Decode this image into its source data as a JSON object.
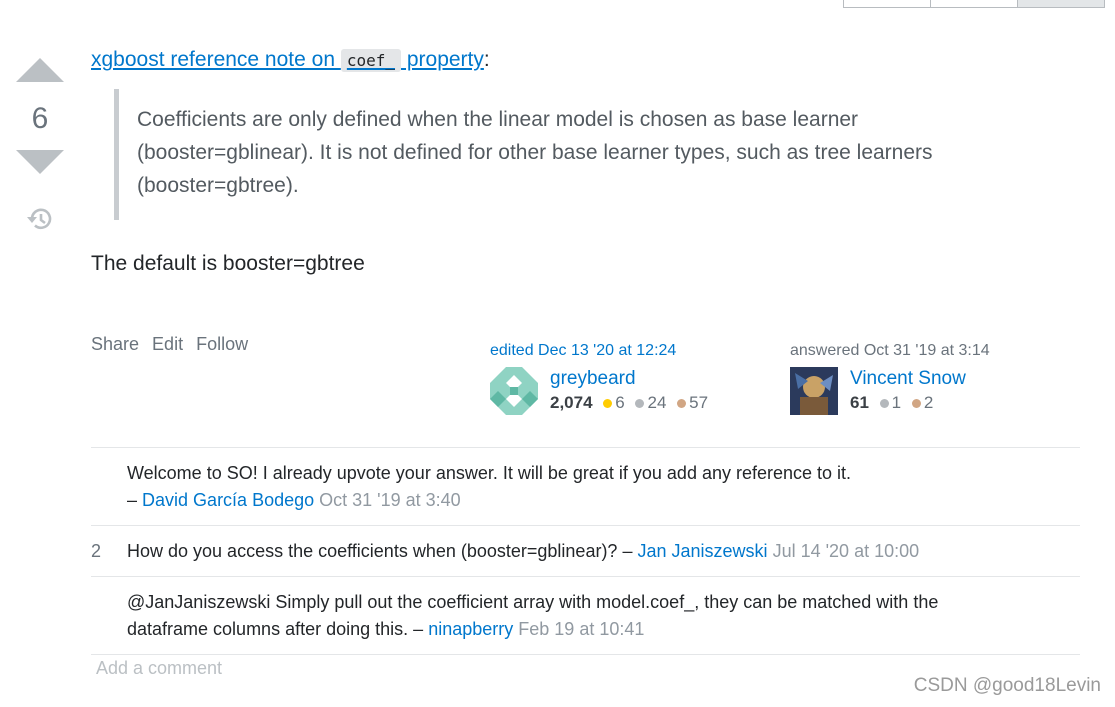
{
  "vote": {
    "score": "6",
    "upvote_icon": "arrow-up-icon",
    "downvote_icon": "arrow-down-icon",
    "history_icon": "history-icon"
  },
  "post": {
    "ref_link_before": "xgboost reference note on ",
    "ref_link_code": "coef_",
    "ref_link_after": " property",
    "ref_colon": ":",
    "quote": "Coefficients are only defined when the linear model is chosen as base learner (booster=gblinear). It is not defined for other base learner types, such as tree learners (booster=gbtree).",
    "paragraph": "The default is booster=gbtree"
  },
  "menu": {
    "share": "Share",
    "edit": "Edit",
    "follow": "Follow"
  },
  "editor": {
    "action": "edited Dec 13 '20 at 12:24",
    "name": "greybeard",
    "rep": "2,074",
    "gold": "6",
    "silver": "24",
    "bronze": "57"
  },
  "author": {
    "action": "answered Oct 31 '19 at 3:14",
    "name": "Vincent Snow",
    "rep": "61",
    "silver": "1",
    "bronze": "2"
  },
  "comments": [
    {
      "score": "",
      "text": "Welcome to SO! I already upvote your answer. It will be great if you add any reference to it.",
      "sep": "–",
      "user": "David García Bodego",
      "date": "Oct 31 '19 at 3:40"
    },
    {
      "score": "2",
      "text": "How do you access the coefficients when (booster=gblinear)?",
      "sep": "–",
      "user": "Jan Janiszewski",
      "date": "Jul 14 '20 at 10:00"
    },
    {
      "score": "",
      "text": "@JanJaniszewski Simply pull out the coefficient array with model.coef_, they can be matched with the dataframe columns after doing this.",
      "sep": "–",
      "user": "ninapberry",
      "date": "Feb 19 at 10:41"
    }
  ],
  "add_comment": "Add a comment",
  "watermark": "CSDN @good18Levin",
  "colors": {
    "link": "#0077cc",
    "muted": "#6a737c",
    "vote_arrow": "#bbc0c4",
    "gold": "#ffcc01",
    "silver": "#b4b8bc",
    "bronze": "#d1a684"
  }
}
